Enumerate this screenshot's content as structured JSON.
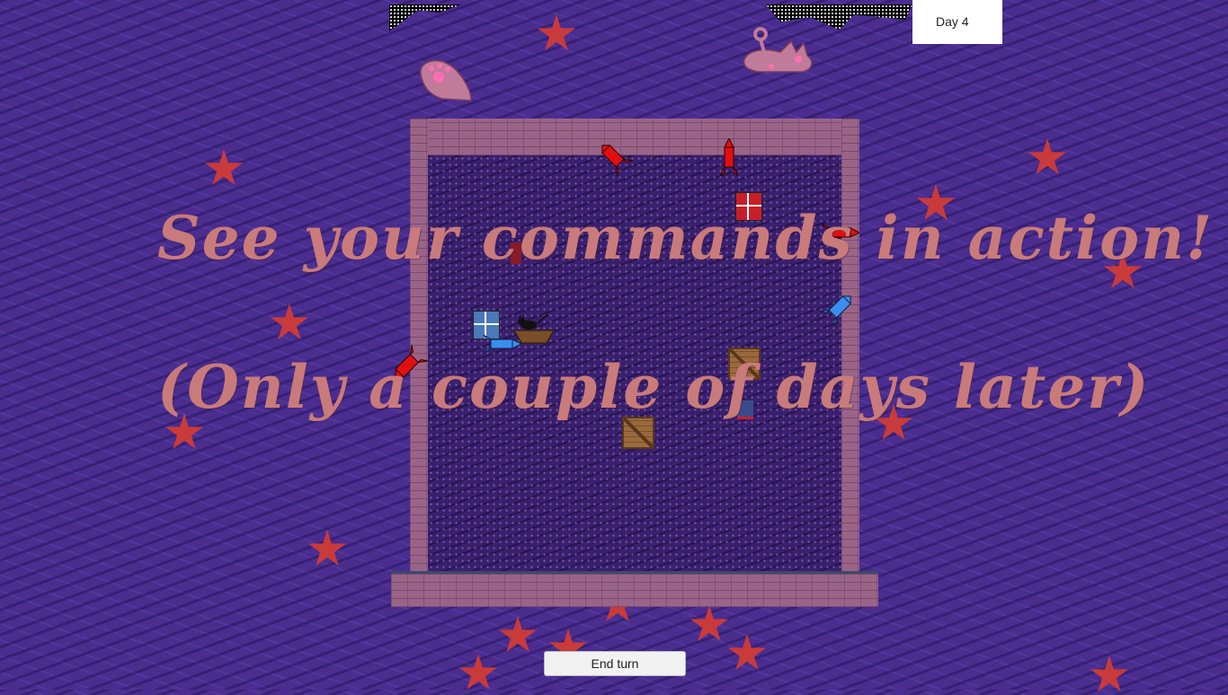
{
  "hud": {
    "day_label": "Day 4",
    "end_turn_label": "End turn"
  },
  "overlay": {
    "line1": "See your commands in action!",
    "line2": "(Only a couple of days later)"
  },
  "colors": {
    "background": "#4a2d8f",
    "star": "#c93a3a",
    "wall": "#9a6488",
    "red_team": "#e01010",
    "blue_team": "#3a8ef0",
    "overlay_text": "#c97b7b"
  },
  "icons": {
    "star": "star-icon",
    "red_rocket": "red-rocket-icon",
    "blue_rocket": "blue-rocket-icon",
    "crate": "wooden-crate-icon",
    "paw": "paw-icon",
    "cat": "cat-icon"
  }
}
